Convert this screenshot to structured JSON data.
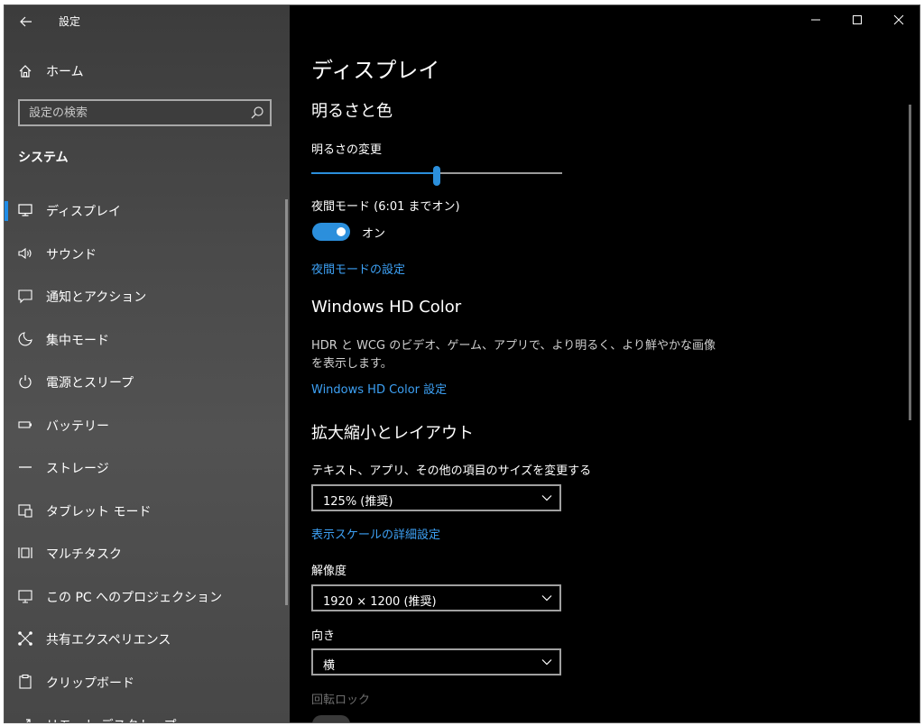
{
  "window": {
    "app_title": "設定",
    "controls": {
      "minimize_icon": "minimize-icon",
      "maximize_icon": "maximize-icon",
      "close_icon": "close-icon"
    }
  },
  "sidebar": {
    "home_label": "ホーム",
    "search_placeholder": "設定の検索",
    "section_title": "システム",
    "items": [
      {
        "label": "ディスプレイ",
        "icon": "monitor-icon",
        "selected": true
      },
      {
        "label": "サウンド",
        "icon": "speaker-icon"
      },
      {
        "label": "通知とアクション",
        "icon": "notification-icon"
      },
      {
        "label": "集中モード",
        "icon": "moon-icon"
      },
      {
        "label": "電源とスリープ",
        "icon": "power-icon"
      },
      {
        "label": "バッテリー",
        "icon": "battery-icon"
      },
      {
        "label": "ストレージ",
        "icon": "storage-icon"
      },
      {
        "label": "タブレット モード",
        "icon": "tablet-icon"
      },
      {
        "label": "マルチタスク",
        "icon": "multitask-icon"
      },
      {
        "label": "この PC へのプロジェクション",
        "icon": "projection-icon"
      },
      {
        "label": "共有エクスペリエンス",
        "icon": "share-icon"
      },
      {
        "label": "クリップボード",
        "icon": "clipboard-icon"
      },
      {
        "label": "リモート デスクトップ",
        "icon": "remote-icon"
      }
    ]
  },
  "main": {
    "page_title": "ディスプレイ",
    "brightness": {
      "heading": "明るさと色",
      "label": "明るさの変更",
      "value_fraction": 0.5
    },
    "night_light": {
      "label": "夜間モード (6:01 までオン)",
      "state_text": "オン",
      "link": "夜間モードの設定"
    },
    "hd_color": {
      "heading": "Windows HD Color",
      "description": "HDR と WCG のビデオ、ゲーム、アプリで、より明るく、より鮮やかな画像を表示します。",
      "link": "Windows HD Color 設定"
    },
    "scale": {
      "heading": "拡大縮小とレイアウト",
      "label": "テキスト、アプリ、その他の項目のサイズを変更する",
      "value": "125% (推奨)",
      "link": "表示スケールの詳細設定"
    },
    "resolution": {
      "label": "解像度",
      "value": "1920 × 1200 (推奨)"
    },
    "orientation": {
      "label": "向き",
      "value": "横"
    },
    "rotation_lock": {
      "label": "回転ロック"
    }
  },
  "colors": {
    "accent": "#2b8fdc",
    "link": "#3da1f5"
  }
}
